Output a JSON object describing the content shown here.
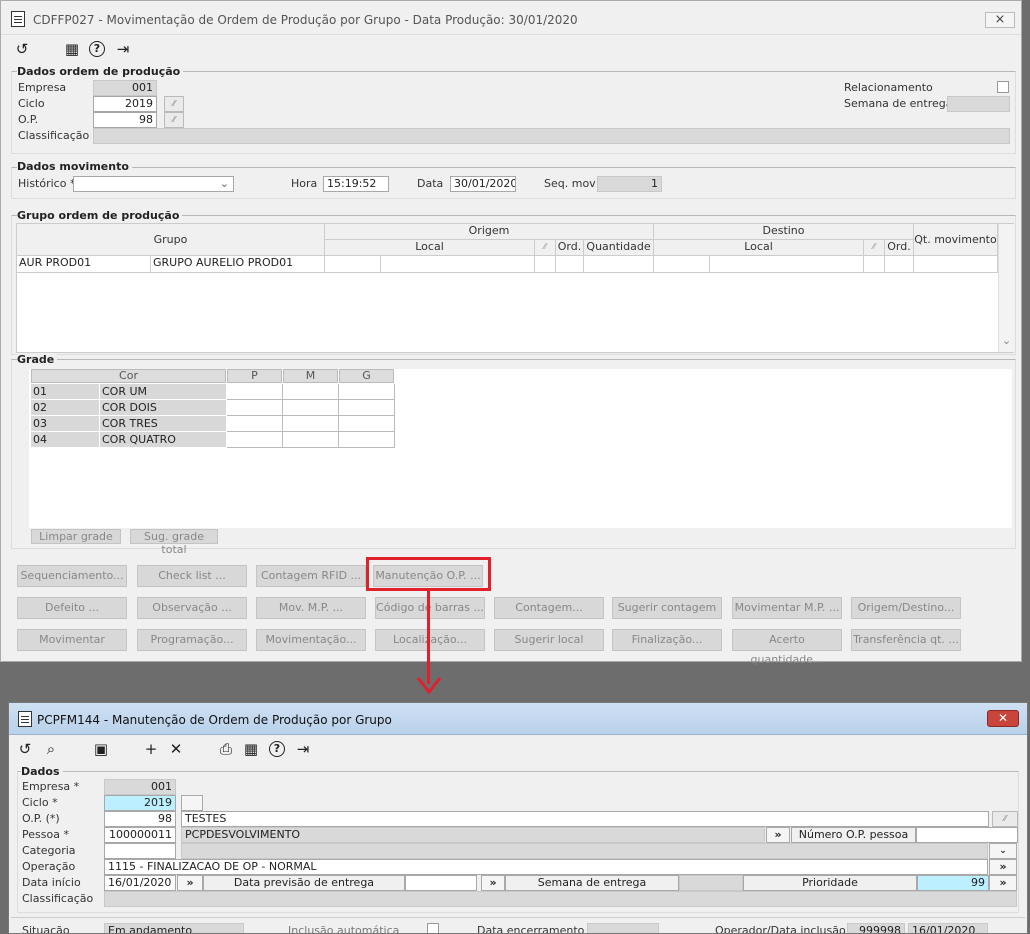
{
  "win1": {
    "title": "CDFFP027 - Movimentação de Ordem de Produção por Grupo - Data Produção: 30/01/2020",
    "close": "⨯",
    "icons": [
      "refresh-icon",
      "calendar-icon",
      "help-icon",
      "exit-icon"
    ],
    "dados_op": {
      "legend": "Dados ordem de produção",
      "empresa_label": "Empresa",
      "empresa": "001",
      "ciclo_label": "Ciclo",
      "ciclo": "2019",
      "op_label": "O.P.",
      "op": "98",
      "classificacao_label": "Classificação",
      "relacionamento_label": "Relacionamento",
      "semana_label": "Semana de entrega"
    },
    "dados_mov": {
      "legend": "Dados movimento",
      "historico_label": "Histórico *",
      "hora_label": "Hora",
      "hora": "15:19:52",
      "data_label": "Data",
      "data": "30/01/2020",
      "seq_label": "Seq. mov",
      "seq": "1"
    },
    "grupo": {
      "legend": "Grupo ordem de produção",
      "col_grupo": "Grupo",
      "col_origem": "Origem",
      "col_destino": "Destino",
      "col_qt": "Qt. movimento",
      "col_local": "Local",
      "col_ord": "Ord.",
      "col_quant": "Quantidade",
      "col_local2": "Local",
      "col_ord2": "Ord.",
      "row_grupo": "AUR PROD01",
      "row_desc": "GRUPO AURELIO PROD01"
    },
    "grade": {
      "legend": "Grade",
      "col_cor": "Cor",
      "sizes": [
        "P",
        "M",
        "G"
      ],
      "rows": [
        {
          "code": "01",
          "name": "COR UM"
        },
        {
          "code": "02",
          "name": "COR DOIS"
        },
        {
          "code": "03",
          "name": "COR TRES"
        },
        {
          "code": "04",
          "name": "COR QUATRO"
        }
      ],
      "limpar": "Limpar grade",
      "sugerir": "Sug. grade total"
    },
    "buttons": {
      "row1": [
        "Sequenciamento...",
        "Check list ...",
        "Contagem RFID ...",
        "Manutenção O.P. ..."
      ],
      "row2": [
        "Defeito ...",
        "Observação ...",
        "Mov. M.P. ...",
        "Código de barras ...",
        "Contagem...",
        "Sugerir contagem",
        "Movimentar M.P. ...",
        "Origem/Destino..."
      ],
      "row3": [
        "Movimentar",
        "Programação...",
        "Movimentação...",
        "Localização...",
        "Sugerir local",
        "Finalização...",
        "Acerto quantidade...",
        "Transferência qt. ..."
      ]
    }
  },
  "win2": {
    "title": "PCPFM144 - Manutenção de Ordem de Produção por Grupo",
    "close": "✕",
    "legend": "Dados",
    "empresa_label": "Empresa *",
    "empresa": "001",
    "ciclo_label": "Ciclo *",
    "ciclo": "2019",
    "op_label": "O.P. (*)",
    "op": "98",
    "op_desc": "TESTES",
    "pessoa_label": "Pessoa *",
    "pessoa": "100000011",
    "pessoa_nome": "PCPDESVOLVIMENTO",
    "num_op_label": "Número O.P. pessoa",
    "categoria_label": "Categoria",
    "operacao_label": "Operação",
    "operacao": "1115 - FINALIZACAO DE OP - NORMAL",
    "data_inicio_label": "Data início",
    "data_inicio": "16/01/2020",
    "previsao_label": "Data previsão de entrega",
    "semana_label": "Semana de entrega",
    "prioridade_label": "Prioridade",
    "prioridade": "99",
    "classificacao_label": "Classificação",
    "situacao_label": "Situação",
    "situacao": "Em andamento",
    "inclusao_label": "Inclusão automática",
    "encerramento_label": "Data encerramento",
    "operador_label": "Operador/Data inclusão",
    "operador": "999998",
    "data_inclusao": "16/01/2020",
    "arrow": "»"
  },
  "accent": "#e0202a"
}
